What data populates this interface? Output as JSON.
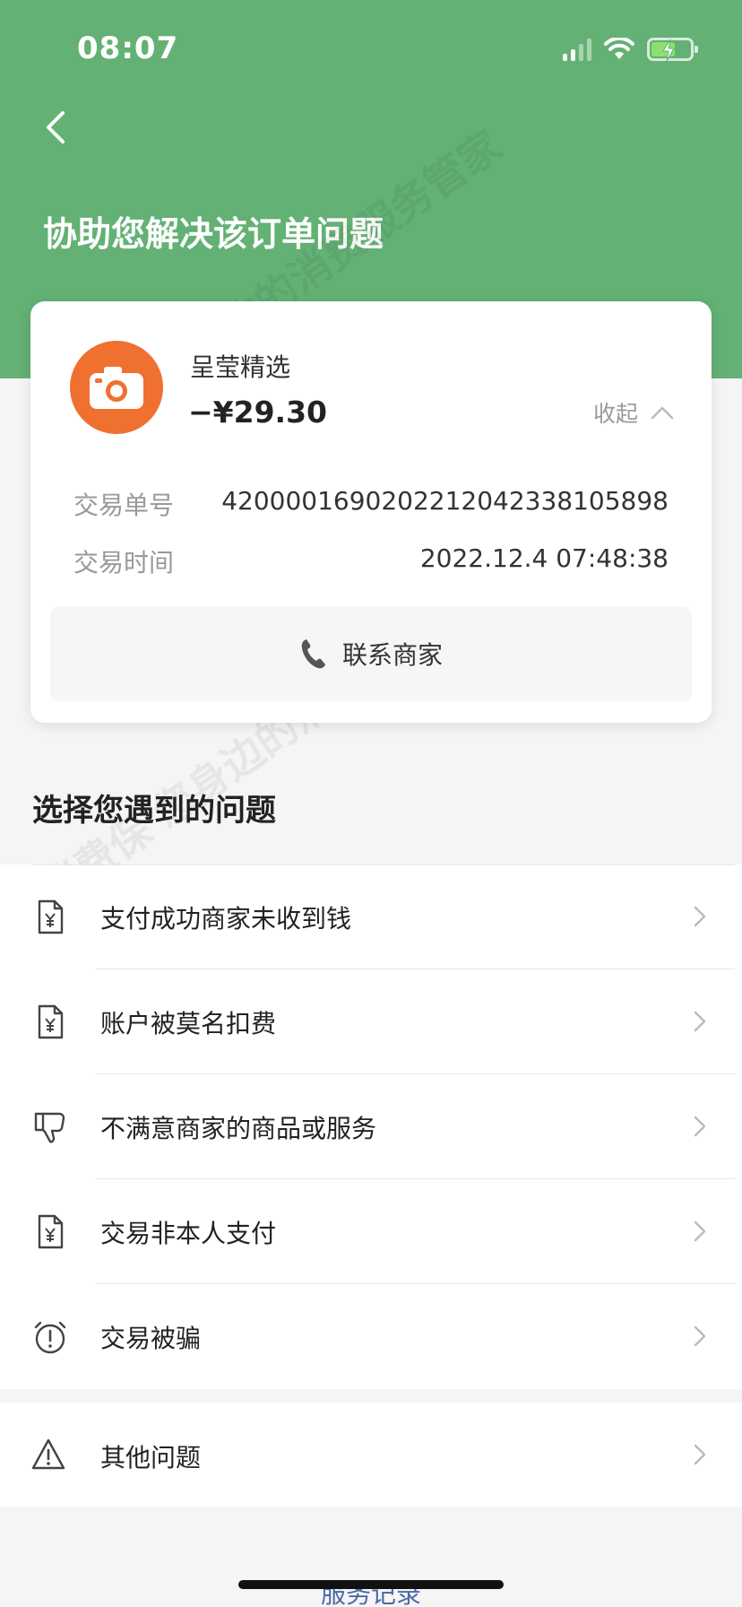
{
  "status_bar": {
    "time": "08:07"
  },
  "header": {
    "title": "协助您解决该订单问题"
  },
  "order_card": {
    "merchant_name": "呈莹精选",
    "amount": "−¥29.30",
    "collapse_label": "收起",
    "transaction_id_label": "交易单号",
    "transaction_id": "4200001690202212042338105898",
    "transaction_time_label": "交易时间",
    "transaction_time": "2022.12.4 07:48:38",
    "contact_label": "联系商家"
  },
  "section": {
    "title": "选择您遇到的问题"
  },
  "issues": [
    {
      "label": "支付成功商家未收到钱",
      "icon": "yuan-document-icon"
    },
    {
      "label": "账户被莫名扣费",
      "icon": "yuan-document-icon"
    },
    {
      "label": "不满意商家的商品或服务",
      "icon": "thumbs-down-icon"
    },
    {
      "label": "交易非本人支付",
      "icon": "yuan-document-icon"
    },
    {
      "label": "交易被骗",
      "icon": "alarm-alert-icon"
    }
  ],
  "other_issue": {
    "label": "其他问题",
    "icon": "warning-triangle-icon"
  },
  "footer": {
    "service_record": "服务记录"
  },
  "watermark_text": "消费保 您身边的消费服务管家",
  "colors": {
    "header_green": "#63b174",
    "merchant_orange": "#f07030",
    "link_blue": "#4b6aa8"
  }
}
